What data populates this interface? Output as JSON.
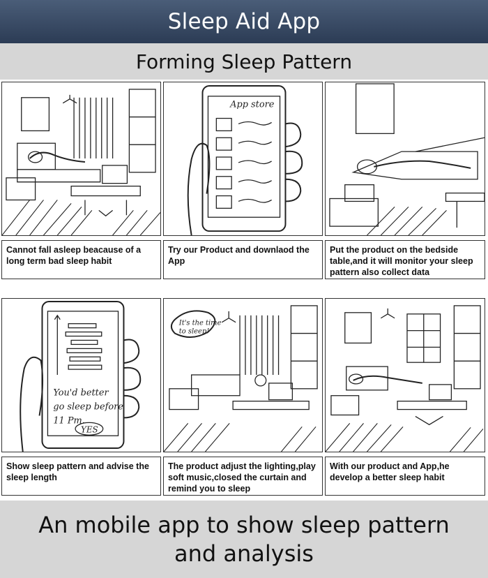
{
  "header": {
    "title": "Sleep Aid App"
  },
  "subheader": {
    "title": "Forming Sleep Pattern"
  },
  "panels": [
    {
      "caption": "Cannot fall asleep beacause of a long term bad sleep habit"
    },
    {
      "caption": "Try our Product and downlaod the App",
      "sketch_text": "App store"
    },
    {
      "caption": "Put the product on the bedside table,and it will monitor your sleep pattern also collect data"
    },
    {
      "caption": "Show sleep pattern and advise the sleep length",
      "sketch_text_1": "You'd better",
      "sketch_text_2": "go sleep before",
      "sketch_text_3": "11 Pm.",
      "sketch_button": "YES"
    },
    {
      "caption": "The product adjust the lighting,play soft music,closed the curtain and remind you to sleep",
      "sketch_text_1": "It's the time",
      "sketch_text_2": "to sleep!"
    },
    {
      "caption": "With our product and App,he develop a better sleep habit"
    }
  ],
  "footer": {
    "text": "An mobile app to show sleep pattern and analysis"
  }
}
